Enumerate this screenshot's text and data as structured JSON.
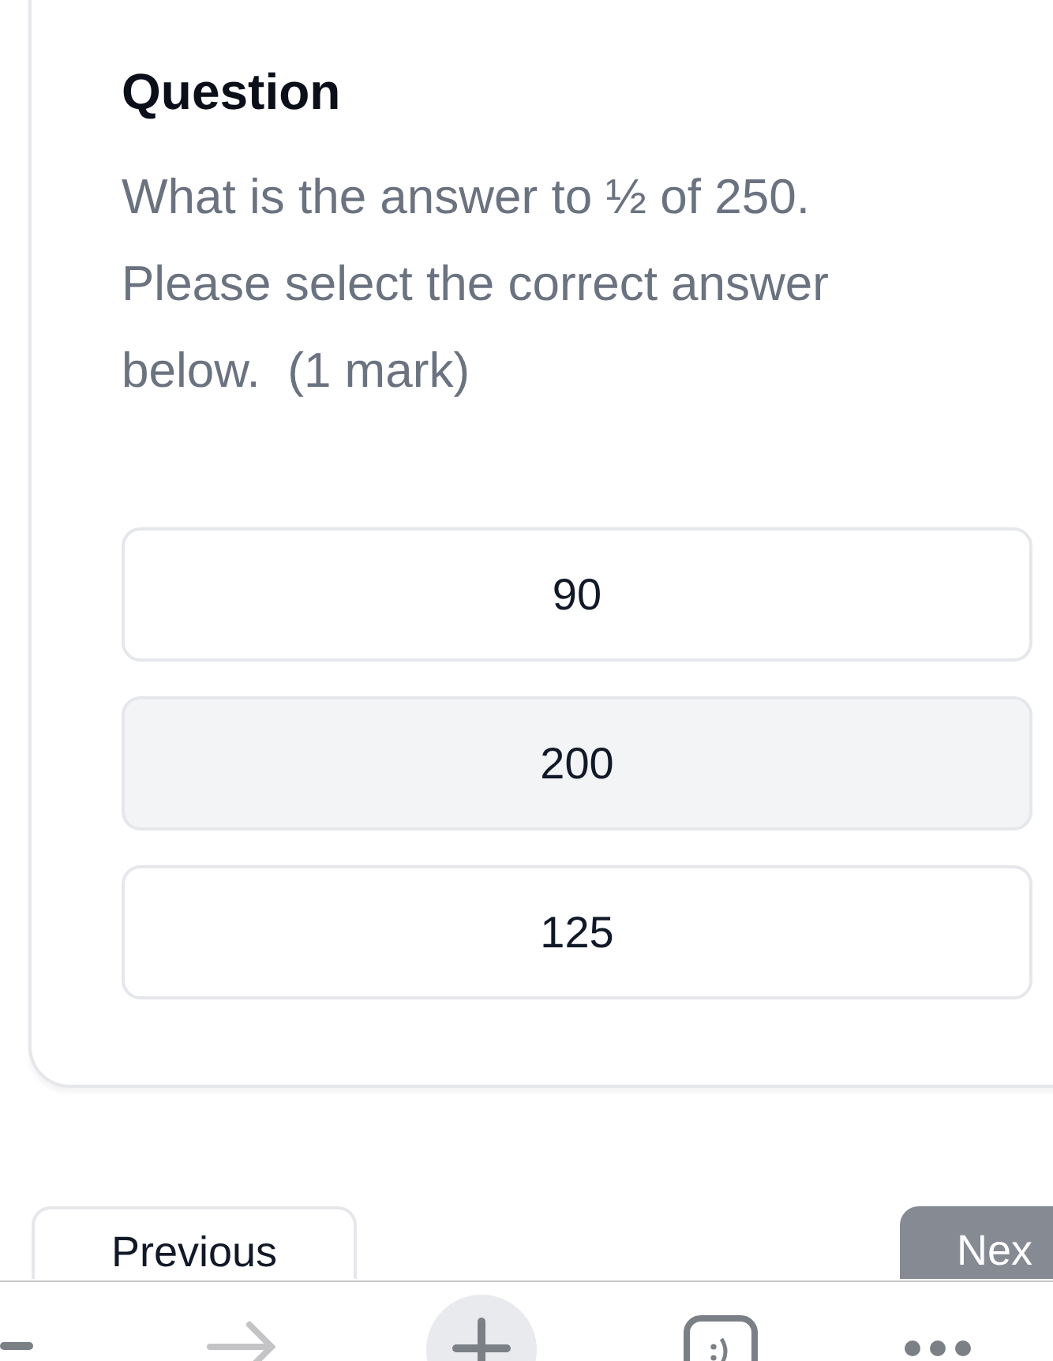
{
  "question": {
    "heading": "Question",
    "text": "What is the answer to ½ of 250. Please select the correct answer below.  (1 mark)"
  },
  "options": [
    {
      "label": "90",
      "selected": false
    },
    {
      "label": "200",
      "selected": true
    },
    {
      "label": "125",
      "selected": false
    }
  ],
  "navigation": {
    "previous": "Previous",
    "next": "Nex"
  }
}
